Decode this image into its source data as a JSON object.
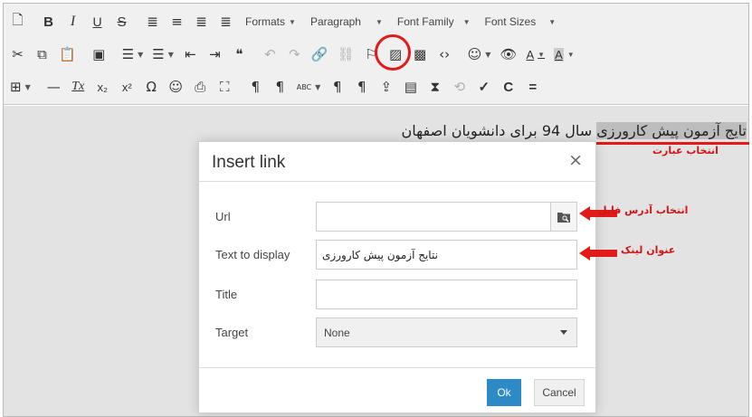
{
  "toolbar": {
    "row1": {
      "new_document": "🗋",
      "bold": "B",
      "italic": "I",
      "underline": "U",
      "strikethrough": "S",
      "align_left": "≣",
      "align_center": "≡",
      "align_right": "≣",
      "justify": "≣",
      "formats": "Formats",
      "paragraph": "Paragraph",
      "font_family": "Font Family",
      "font_sizes": "Font Sizes"
    },
    "row2": {
      "cut": "✂",
      "copy": "⧉",
      "paste": "📋",
      "find": "▣",
      "bullet_list": "☰",
      "numbered_list": "☰",
      "outdent": "⇤",
      "indent": "⇥",
      "blockquote": "❝",
      "undo": "↶",
      "redo": "↷",
      "insert_link": "🔗",
      "unlink": "⛓",
      "anchor": "⚐",
      "image": "▨",
      "media": "▩",
      "code": "‹›",
      "emoticons": "☺",
      "preview": "👁",
      "text_color": "A",
      "background_color": "A"
    },
    "row3": {
      "table": "⊞",
      "hr": "—",
      "remove_format": "Tx",
      "subscript": "x₂",
      "superscript": "x²",
      "special_char": "Ω",
      "emoticon": "☺",
      "print": "⎙",
      "fullscreen": "⛶",
      "ltr": "¶",
      "rtl": "¶",
      "spellcheck": "ABC",
      "show_blocks": "¶",
      "visual_chars": "¶",
      "upload": "⇪",
      "template": "▤",
      "pagebreak": "⧗",
      "restore": "⟲",
      "check": "✓",
      "c": "C",
      "equal": "="
    },
    "accent_color": "#e11a1a"
  },
  "content": {
    "plain_text": "سال 94 برای دانشویان اصفهان",
    "selected_text": "تایج آزمون پیش کارورزی",
    "annotation_select_phrase": "انتخاب عبارت"
  },
  "dialog": {
    "title": "Insert link",
    "close": "×",
    "fields": {
      "url_label": "Url",
      "url_value": "",
      "text_label": "Text to display",
      "text_value": "نتایج آزمون پیش کارورزی",
      "title_label": "Title",
      "title_value": "",
      "target_label": "Target",
      "target_value": "None"
    },
    "ok": "Ok",
    "cancel": "Cancel",
    "ok_color": "#2d8ac7"
  },
  "annotations": {
    "file_address": "انتخاب آدرس فایل",
    "link_title": "عنوان لینک"
  }
}
